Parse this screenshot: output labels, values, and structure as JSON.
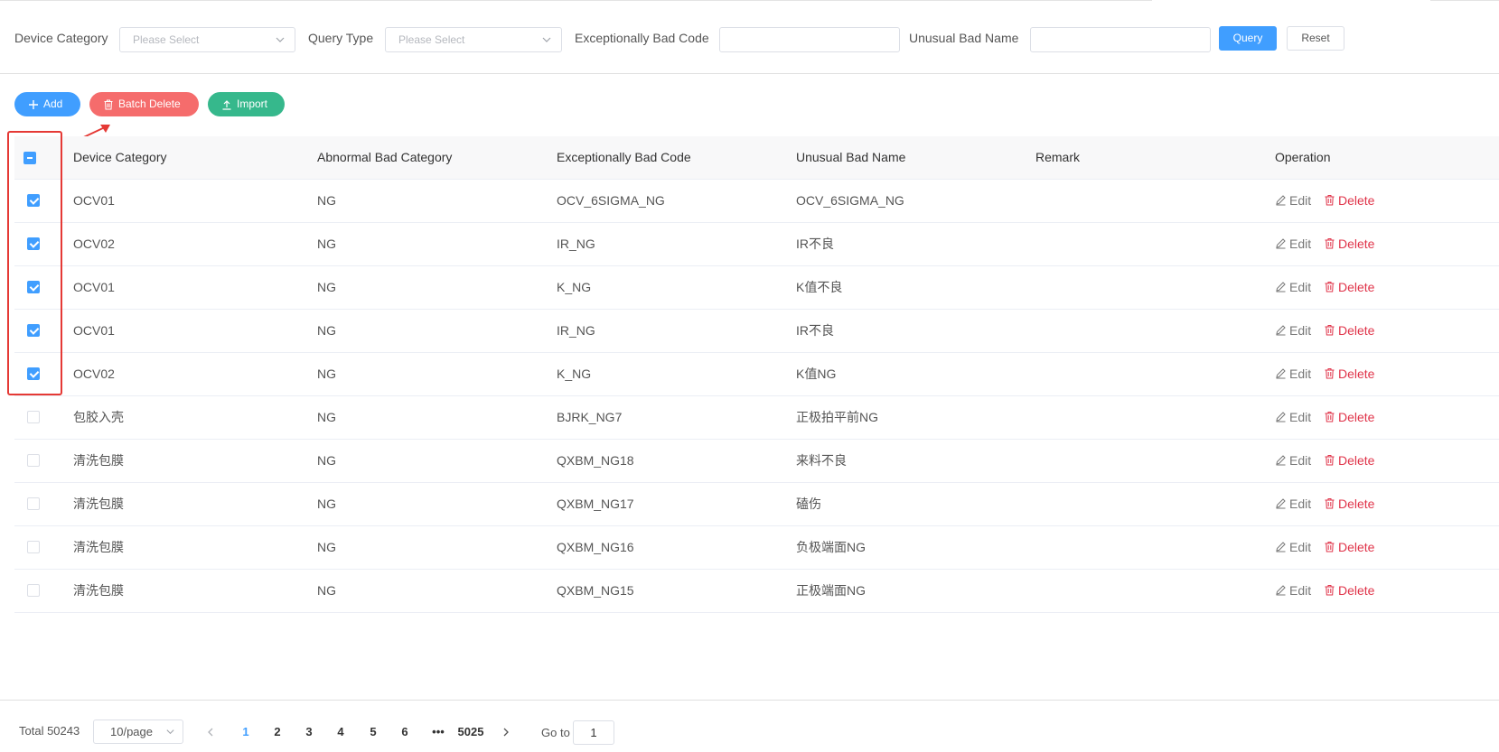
{
  "filters": {
    "device_category_label": "Device Category",
    "device_category_placeholder": "Please Select",
    "query_type_label": "Query Type",
    "query_type_placeholder": "Please Select",
    "bad_code_label": "Exceptionally Bad Code",
    "bad_name_label": "Unusual Bad Name",
    "query_button": "Query",
    "reset_button": "Reset"
  },
  "toolbar": {
    "add_label": "Add",
    "batch_delete_label": "Batch Delete",
    "import_label": "Import"
  },
  "table": {
    "columns": [
      "Device Category",
      "Abnormal Bad Category",
      "Exceptionally Bad Code",
      "Unusual Bad Name",
      "Remark",
      "Operation"
    ],
    "edit_label": "Edit",
    "delete_label": "Delete",
    "rows": [
      {
        "checked": true,
        "device": "OCV01",
        "category": "NG",
        "code": "OCV_6SIGMA_NG",
        "name": "OCV_6SIGMA_NG",
        "remark": ""
      },
      {
        "checked": true,
        "device": "OCV02",
        "category": "NG",
        "code": "IR_NG",
        "name": "IR不良",
        "remark": ""
      },
      {
        "checked": true,
        "device": "OCV01",
        "category": "NG",
        "code": "K_NG",
        "name": "K值不良",
        "remark": ""
      },
      {
        "checked": true,
        "device": "OCV01",
        "category": "NG",
        "code": "IR_NG",
        "name": "IR不良",
        "remark": ""
      },
      {
        "checked": true,
        "device": "OCV02",
        "category": "NG",
        "code": "K_NG",
        "name": "K值NG",
        "remark": ""
      },
      {
        "checked": false,
        "device": "包胶入壳",
        "category": "NG",
        "code": "BJRK_NG7",
        "name": "正极拍平前NG",
        "remark": ""
      },
      {
        "checked": false,
        "device": "清洗包膜",
        "category": "NG",
        "code": "QXBM_NG18",
        "name": "来料不良",
        "remark": ""
      },
      {
        "checked": false,
        "device": "清洗包膜",
        "category": "NG",
        "code": "QXBM_NG17",
        "name": "磕伤",
        "remark": ""
      },
      {
        "checked": false,
        "device": "清洗包膜",
        "category": "NG",
        "code": "QXBM_NG16",
        "name": "负极端面NG",
        "remark": ""
      },
      {
        "checked": false,
        "device": "清洗包膜",
        "category": "NG",
        "code": "QXBM_NG15",
        "name": "正极端面NG",
        "remark": ""
      }
    ]
  },
  "pagination": {
    "total_text": "Total 50243",
    "page_size": "10/page",
    "pages": [
      "1",
      "2",
      "3",
      "4",
      "5",
      "6"
    ],
    "ellipsis": "•••",
    "last_page": "5025",
    "current_page": "1",
    "goto_label": "Go to",
    "goto_value": "1"
  },
  "colors": {
    "primary": "#409eff",
    "danger": "#f56c6c",
    "success": "#36b88c",
    "delete_text": "#e0344a",
    "annotation": "#e53935"
  }
}
